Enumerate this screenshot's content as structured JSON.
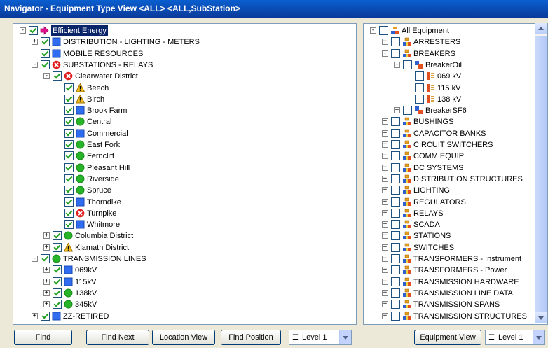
{
  "window": {
    "title": "Navigator - Equipment Type View <ALL> <ALL,SubStation>"
  },
  "left_tree": [
    {
      "label": "Efficient Energy",
      "icon": "arrow-icon",
      "expander": "-",
      "checked": true,
      "selected": true
    },
    {
      "label": "DISTRIBUTION - LIGHTING - METERS",
      "icon": "blue-square-icon",
      "expander": "+",
      "checked": true
    },
    {
      "label": "MOBILE RESOURCES",
      "icon": "blue-square-icon",
      "expander": "",
      "checked": true
    },
    {
      "label": "SUBSTATIONS - RELAYS",
      "icon": "red-x-icon",
      "expander": "-",
      "checked": true
    },
    {
      "label": "Clearwater District",
      "icon": "red-x-icon",
      "expander": "-",
      "checked": true
    },
    {
      "label": "Beech",
      "icon": "warning-icon",
      "expander": "",
      "checked": true
    },
    {
      "label": "Birch",
      "icon": "warning-icon",
      "expander": "",
      "checked": true
    },
    {
      "label": "Brook Farm",
      "icon": "blue-square-icon",
      "expander": "",
      "checked": true
    },
    {
      "label": "Central",
      "icon": "green-circle-icon",
      "expander": "",
      "checked": true
    },
    {
      "label": "Commercial",
      "icon": "blue-square-icon",
      "expander": "",
      "checked": true
    },
    {
      "label": "East Fork",
      "icon": "green-circle-icon",
      "expander": "",
      "checked": true
    },
    {
      "label": "Ferncliff",
      "icon": "green-circle-icon",
      "expander": "",
      "checked": true
    },
    {
      "label": "Pleasant Hill",
      "icon": "green-circle-icon",
      "expander": "",
      "checked": true
    },
    {
      "label": "Riverside",
      "icon": "green-circle-icon",
      "expander": "",
      "checked": true
    },
    {
      "label": "Spruce",
      "icon": "green-circle-icon",
      "expander": "",
      "checked": true
    },
    {
      "label": "Thorndike",
      "icon": "blue-square-icon",
      "expander": "",
      "checked": true
    },
    {
      "label": "Turnpike",
      "icon": "red-x-icon",
      "expander": "",
      "checked": true
    },
    {
      "label": "Whitmore",
      "icon": "blue-square-icon",
      "expander": "",
      "checked": true
    },
    {
      "label": "Columbia District",
      "icon": "green-circle-icon",
      "expander": "+",
      "checked": true
    },
    {
      "label": "Klamath District",
      "icon": "warning-icon",
      "expander": "+",
      "checked": true
    },
    {
      "label": "TRANSMISSION LINES",
      "icon": "green-circle-icon",
      "expander": "-",
      "checked": true
    },
    {
      "label": "069kV",
      "icon": "blue-square-icon",
      "expander": "+",
      "checked": true
    },
    {
      "label": "115kV",
      "icon": "blue-square-icon",
      "expander": "+",
      "checked": true
    },
    {
      "label": "138kV",
      "icon": "green-circle-icon",
      "expander": "+",
      "checked": true
    },
    {
      "label": "345kV",
      "icon": "green-circle-icon",
      "expander": "+",
      "checked": true
    },
    {
      "label": "ZZ-RETIRED",
      "icon": "blue-square-icon",
      "expander": "+",
      "checked": true
    }
  ],
  "right_tree": [
    {
      "label": "All Equipment",
      "icon": "equipment-group-icon",
      "expander": "-",
      "checked": false
    },
    {
      "label": "ARRESTERS",
      "icon": "equipment-icon",
      "expander": "+",
      "checked": false
    },
    {
      "label": "BREAKERS",
      "icon": "equipment-icon",
      "expander": "-",
      "checked": false
    },
    {
      "label": "BreakerOil",
      "icon": "breaker-icon",
      "expander": "-",
      "checked": false
    },
    {
      "label": "069 kV",
      "icon": "voltage-icon",
      "expander": "",
      "checked": false
    },
    {
      "label": "115 kV",
      "icon": "voltage-icon",
      "expander": "",
      "checked": false
    },
    {
      "label": "138 kV",
      "icon": "voltage-icon",
      "expander": "",
      "checked": false
    },
    {
      "label": "BreakerSF6",
      "icon": "breaker-icon",
      "expander": "+",
      "checked": false
    },
    {
      "label": "BUSHINGS",
      "icon": "equipment-icon",
      "expander": "+",
      "checked": false
    },
    {
      "label": "CAPACITOR BANKS",
      "icon": "equipment-icon",
      "expander": "+",
      "checked": false
    },
    {
      "label": "CIRCUIT SWITCHERS",
      "icon": "equipment-icon",
      "expander": "+",
      "checked": false
    },
    {
      "label": "COMM EQUIP",
      "icon": "equipment-icon",
      "expander": "+",
      "checked": false
    },
    {
      "label": "DC SYSTEMS",
      "icon": "equipment-icon",
      "expander": "+",
      "checked": false
    },
    {
      "label": "DISTRIBUTION STRUCTURES",
      "icon": "equipment-icon",
      "expander": "+",
      "checked": false
    },
    {
      "label": "LIGHTING",
      "icon": "equipment-icon",
      "expander": "+",
      "checked": false
    },
    {
      "label": "REGULATORS",
      "icon": "equipment-icon",
      "expander": "+",
      "checked": false
    },
    {
      "label": "RELAYS",
      "icon": "equipment-icon",
      "expander": "+",
      "checked": false
    },
    {
      "label": "SCADA",
      "icon": "equipment-icon",
      "expander": "+",
      "checked": false
    },
    {
      "label": "STATIONS",
      "icon": "equipment-icon",
      "expander": "+",
      "checked": false
    },
    {
      "label": "SWITCHES",
      "icon": "equipment-icon",
      "expander": "+",
      "checked": false
    },
    {
      "label": "TRANSFORMERS - Instrument",
      "icon": "equipment-icon",
      "expander": "+",
      "checked": false
    },
    {
      "label": "TRANSFORMERS - Power",
      "icon": "equipment-icon",
      "expander": "+",
      "checked": false
    },
    {
      "label": "TRANSMISSION HARDWARE",
      "icon": "equipment-icon",
      "expander": "+",
      "checked": false
    },
    {
      "label": "TRANSMISSION LINE DATA",
      "icon": "equipment-icon",
      "expander": "+",
      "checked": false
    },
    {
      "label": "TRANSMISSION SPANS",
      "icon": "equipment-icon",
      "expander": "+",
      "checked": false
    },
    {
      "label": "TRANSMISSION STRUCTURES",
      "icon": "equipment-icon",
      "expander": "+",
      "checked": false
    }
  ],
  "toolbar": {
    "find": "Find",
    "find_next": "Find Next",
    "location_view": "Location View",
    "find_position": "Find Position",
    "level_left": "Level 1",
    "equipment_view": "Equipment View",
    "level_right": "Level 1"
  },
  "colors": {
    "title_bar": "#0a3a9a",
    "selection": "#0a246a",
    "status_green": "#28b428",
    "status_blue": "#2f6cf0",
    "status_red": "#e02020",
    "status_yellow": "#f0c020"
  }
}
